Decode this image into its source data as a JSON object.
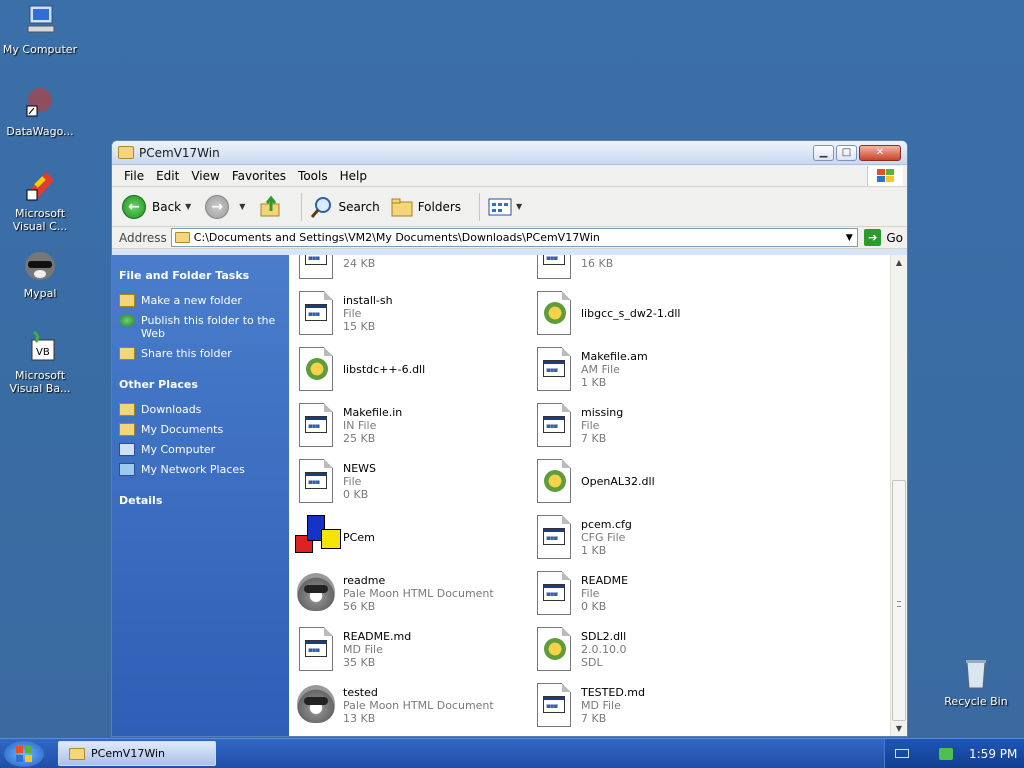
{
  "desktop": {
    "icons": [
      {
        "label": "My Computer",
        "icon": "my-computer-icon"
      },
      {
        "label": "DataWago...",
        "icon": "datawagon-icon"
      },
      {
        "label": "Microsoft Visual C...",
        "icon": "visual-c-icon"
      },
      {
        "label": "Mypal",
        "icon": "mypal-raccoon-icon"
      },
      {
        "label": "Microsoft Visual Ba...",
        "icon": "visual-basic-icon"
      },
      {
        "label": "Recycle Bin",
        "icon": "recycle-bin-icon"
      }
    ]
  },
  "window": {
    "title": "PCemV17Win",
    "menu": [
      "File",
      "Edit",
      "View",
      "Favorites",
      "Tools",
      "Help"
    ],
    "toolbar": {
      "back": "Back",
      "search": "Search",
      "folders": "Folders"
    },
    "address": {
      "label": "Address",
      "path": "C:\\Documents and Settings\\VM2\\My Documents\\Downloads\\PCemV17Win",
      "go": "Go"
    }
  },
  "leftpane": {
    "tasks_title": "File and Folder Tasks",
    "tasks": [
      "Make a new folder",
      "Publish this folder to the Web",
      "Share this folder"
    ],
    "places_title": "Other Places",
    "places": [
      "Downloads",
      "My Documents",
      "My Computer",
      "My Network Places"
    ],
    "details_title": "Details"
  },
  "files": [
    {
      "name": "",
      "type": "File",
      "size": "24 KB",
      "kind": "doc"
    },
    {
      "name": "",
      "type": "File",
      "size": "16 KB",
      "kind": "doc"
    },
    {
      "name": "install-sh",
      "type": "File",
      "size": "15 KB",
      "kind": "doc"
    },
    {
      "name": "libgcc_s_dw2-1.dll",
      "type": "",
      "size": "",
      "kind": "dll"
    },
    {
      "name": "libstdc++-6.dll",
      "type": "",
      "size": "",
      "kind": "dll"
    },
    {
      "name": "Makefile.am",
      "type": "AM File",
      "size": "1 KB",
      "kind": "doc"
    },
    {
      "name": "Makefile.in",
      "type": "IN File",
      "size": "25 KB",
      "kind": "doc"
    },
    {
      "name": "missing",
      "type": "File",
      "size": "7 KB",
      "kind": "doc"
    },
    {
      "name": "NEWS",
      "type": "File",
      "size": "0 KB",
      "kind": "doc"
    },
    {
      "name": "OpenAL32.dll",
      "type": "",
      "size": "",
      "kind": "dll"
    },
    {
      "name": "PCem",
      "type": "",
      "size": "",
      "kind": "pcem"
    },
    {
      "name": "pcem.cfg",
      "type": "CFG File",
      "size": "1 KB",
      "kind": "doc"
    },
    {
      "name": "readme",
      "type": "Pale Moon HTML Document",
      "size": "56 KB",
      "kind": "raccoon"
    },
    {
      "name": "README",
      "type": "File",
      "size": "0 KB",
      "kind": "doc"
    },
    {
      "name": "README.md",
      "type": "MD File",
      "size": "35 KB",
      "kind": "doc"
    },
    {
      "name": "SDL2.dll",
      "type": "2.0.10.0",
      "size": "SDL",
      "kind": "dll"
    },
    {
      "name": "tested",
      "type": "Pale Moon HTML Document",
      "size": "13 KB",
      "kind": "raccoon"
    },
    {
      "name": "TESTED.md",
      "type": "MD File",
      "size": "7 KB",
      "kind": "doc"
    }
  ],
  "taskbar": {
    "task": "PCemV17Win",
    "time": "1:59 PM"
  }
}
